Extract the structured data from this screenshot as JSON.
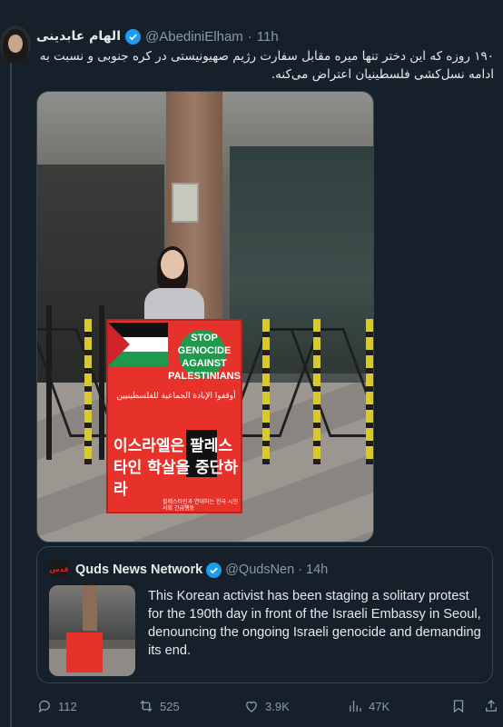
{
  "tweet": {
    "author_name": "الهام عابدینی",
    "handle": "@AbediniElham",
    "separator": "·",
    "time": "11h",
    "text": "۱۹۰ روزه که این دختر تنها میره مقابل سفارت رژیم صهیونیستی در کره جنوبی و نسبت به ادامه نسل‌کشی فلسطینیان اعتراض می‌کنه."
  },
  "photo_sign": {
    "english": "STOP GENOCIDE AGAINST PALESTINIANS",
    "arabic": "أوقفوا الإبادة الجماعية للفلسطينيين",
    "korean": "이스라엘은 팔레스타인 학살을 중단하라",
    "small_print": "팔레스타인과 연대하는 한국 시민사회 긴급행동"
  },
  "quote": {
    "avatar_text": "قدس",
    "author_name": "Quds News Network",
    "handle": "@QudsNen",
    "separator": "·",
    "time": "14h",
    "text": "This Korean activist has been staging a solitary protest for the 190th day in front of the Israeli Embassy in Seoul, denouncing the ongoing Israeli genocide and demanding its end."
  },
  "actions": {
    "replies": "112",
    "retweets": "525",
    "likes": "3.9K",
    "views": "47K"
  },
  "icons": {
    "verified": "verified-badge-icon",
    "reply": "reply-icon",
    "retweet": "retweet-icon",
    "like": "heart-icon",
    "views": "views-chart-icon",
    "bookmark": "bookmark-icon",
    "share": "share-icon"
  },
  "colors": {
    "background": "#15202b",
    "accent": "#1d9bf0",
    "muted": "#8b98a5",
    "sign_red": "#e6322a"
  }
}
